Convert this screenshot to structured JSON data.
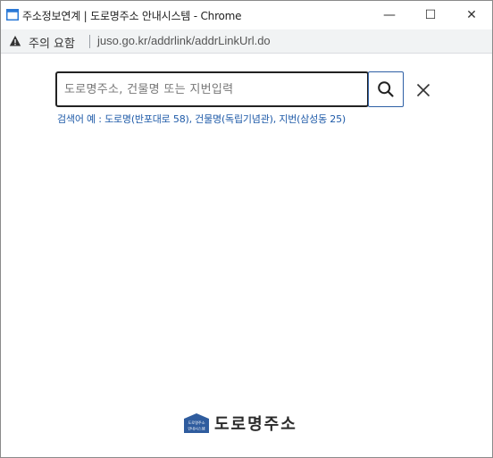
{
  "window": {
    "title": "주소정보연계 | 도로명주소 안내시스템 - Chrome",
    "minimize_glyph": "—",
    "maximize_glyph": "☐",
    "close_glyph": "✕"
  },
  "addressbar": {
    "security_warning": "주의 요함",
    "url": "juso.go.kr/addrlink/addrLinkUrl.do"
  },
  "search": {
    "placeholder": "도로명주소, 건물명 또는 지번입력",
    "value": "",
    "example": "검색어 예 : 도로명(반포대로 58), 건물명(독립기념관), 지번(삼성동 25)"
  },
  "footer": {
    "logo_mark_text": "도로명주소 안내시스템",
    "logo_text": "도로명주소"
  },
  "colors": {
    "accent_blue": "#1e5aa8",
    "search_button_border": "#2d5fa5",
    "logo_blue": "#2f5c9e"
  },
  "icons": {
    "app": "chrome-window-icon",
    "warning": "warning-triangle-icon",
    "search": "magnifier-icon",
    "close": "close-x-icon"
  }
}
